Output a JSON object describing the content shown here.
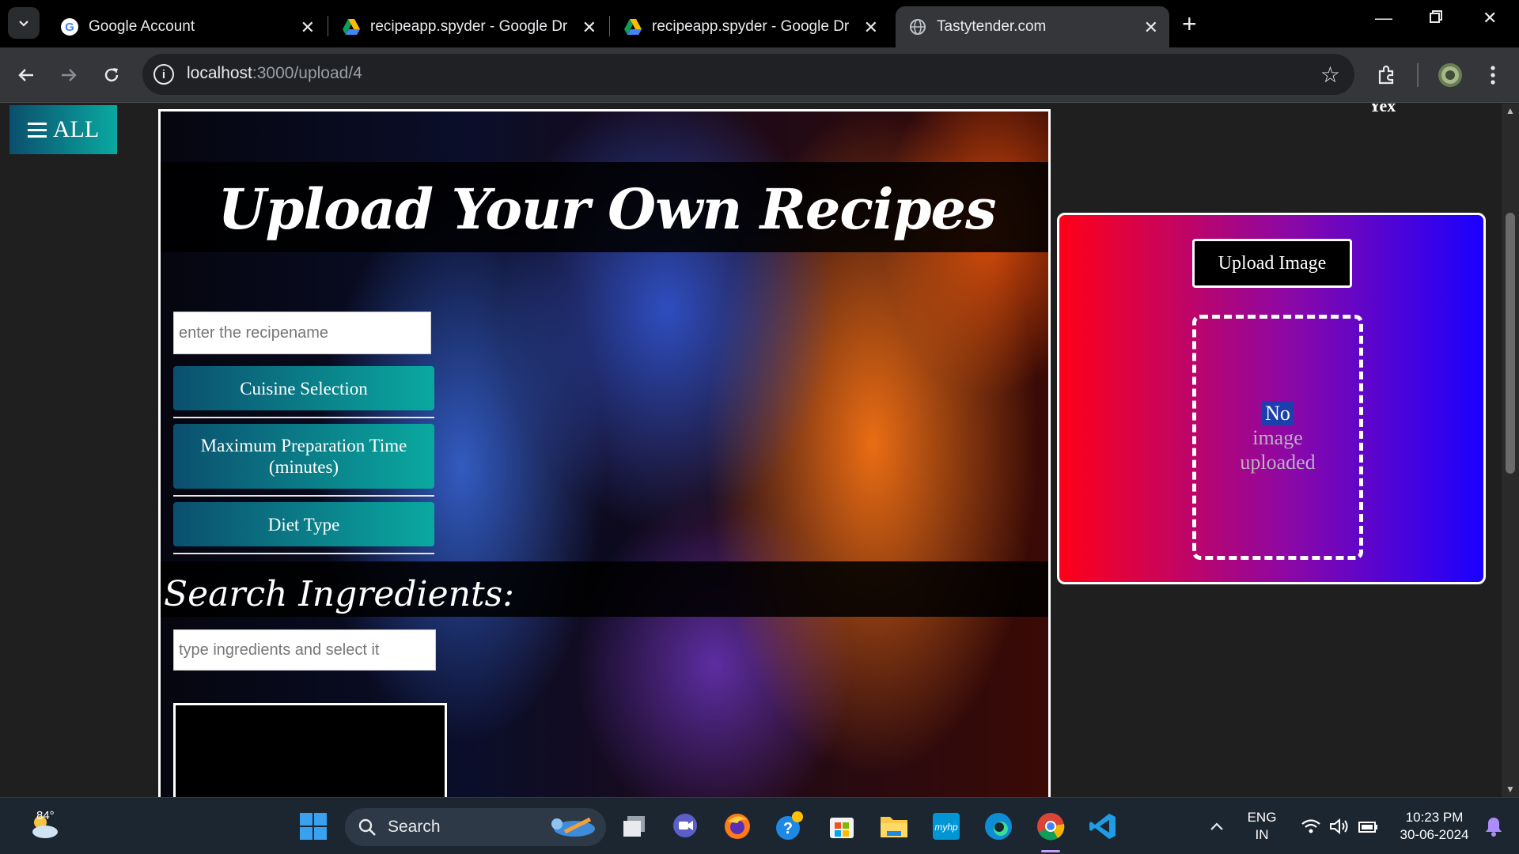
{
  "browser": {
    "tabs": [
      {
        "title": "Google Account",
        "icon": "google-icon",
        "active": false
      },
      {
        "title": "recipeapp.spyder - Google Drive",
        "icon": "drive-icon",
        "active": false
      },
      {
        "title": "recipeapp.spyder - Google Drive",
        "icon": "drive-icon",
        "active": false
      },
      {
        "title": "Tastytender.com",
        "icon": "globe-icon",
        "active": true
      }
    ],
    "url_host": "localhost",
    "url_path": ":3000/upload/4"
  },
  "page": {
    "all_label": "ALL",
    "partial_text": "Yex",
    "title": "Upload Your Own Recipes",
    "recipe_input_placeholder": "enter the recipename",
    "cuisine_label": "Cuisine Selection",
    "prep_time_label": "Maximum Preparation Time (minutes)",
    "diet_label": "Diet Type",
    "search_heading": "Search Ingredients:",
    "ingredients_placeholder": "type ingredients and select it",
    "upload_button": "Upload Image",
    "no_image_word1": "No",
    "no_image_rest1": "image",
    "no_image_rest2": "uploaded"
  },
  "taskbar": {
    "weather_temp": "84°",
    "search_label": "Search",
    "lang_line1": "ENG",
    "lang_line2": "IN",
    "time": "10:23 PM",
    "date": "30-06-2024"
  }
}
